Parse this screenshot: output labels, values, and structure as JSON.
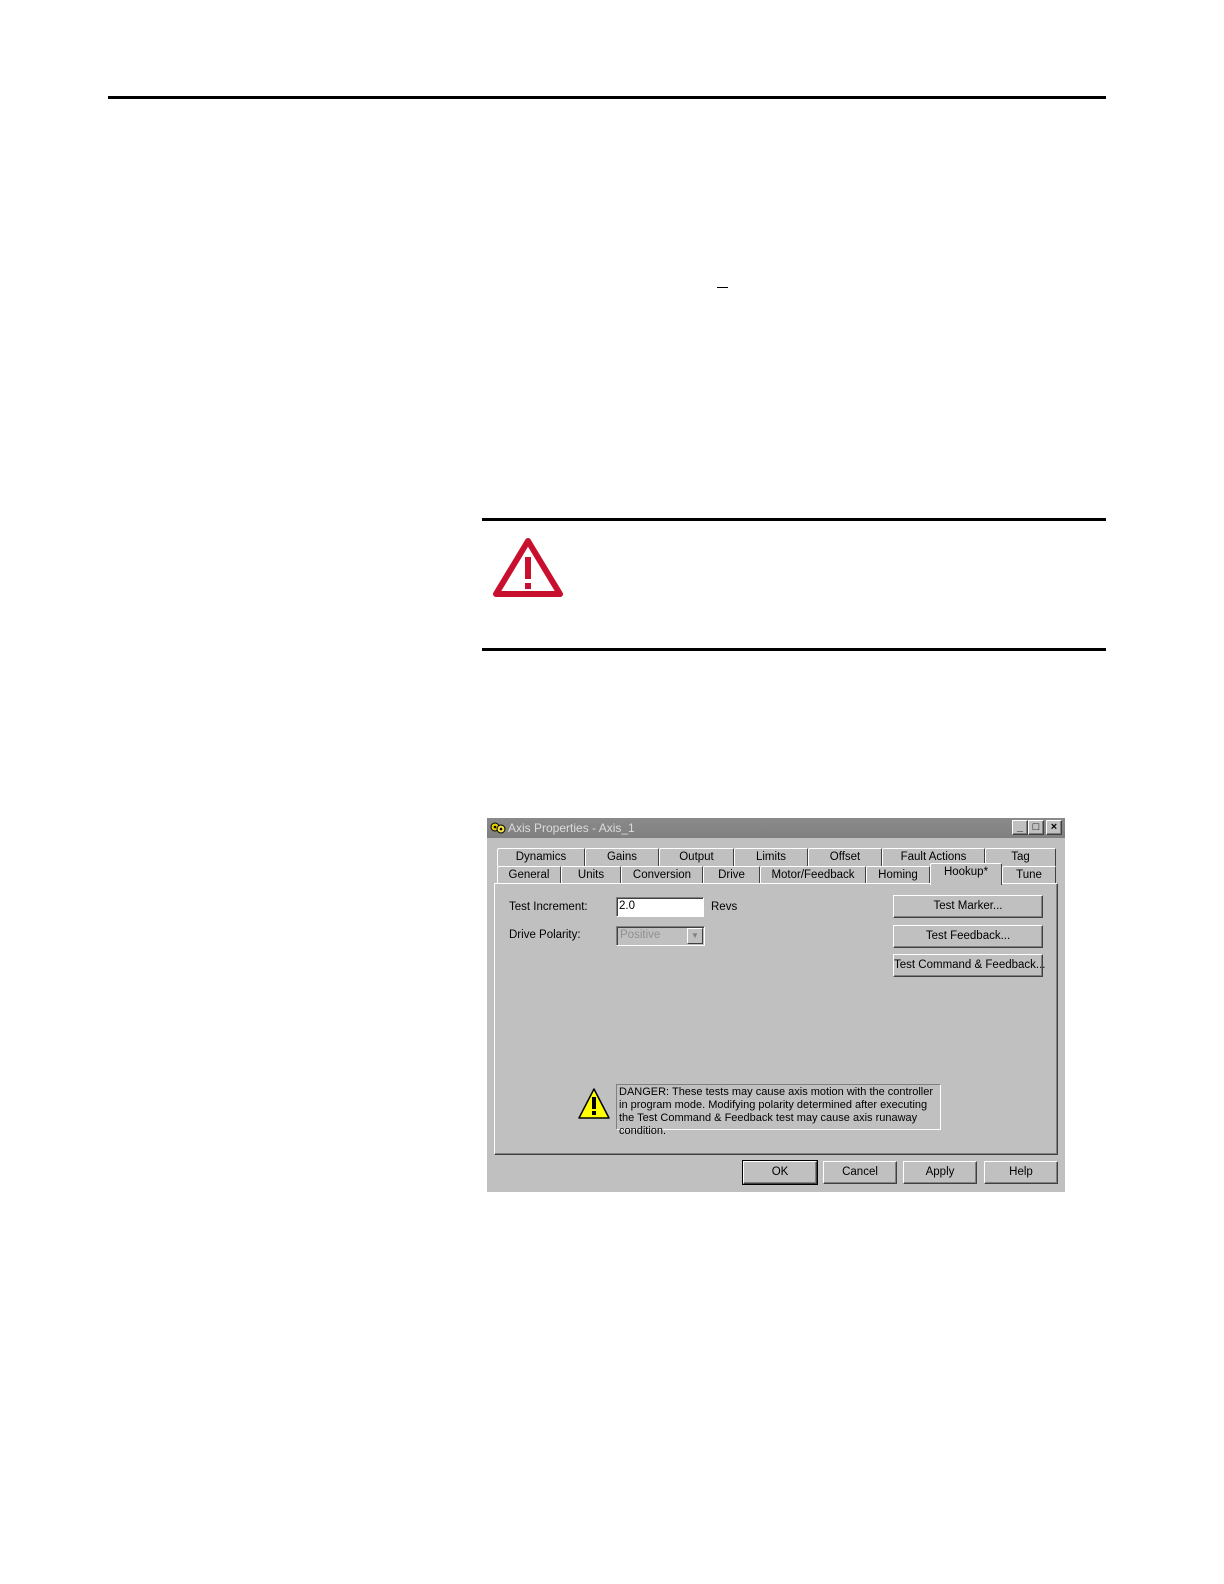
{
  "dialog": {
    "title": "Axis Properties - Axis_1",
    "window_buttons": {
      "minimize": "_",
      "maximize": "□",
      "close": "×"
    },
    "tabs_back_row": [
      "Dynamics",
      "Gains",
      "Output",
      "Limits",
      "Offset",
      "Fault Actions",
      "Tag"
    ],
    "tabs_front_row": [
      "General",
      "Units",
      "Conversion",
      "Drive",
      "Motor/Feedback",
      "Homing",
      "Hookup*",
      "Tune"
    ],
    "active_tab": "Hookup*",
    "test_increment": {
      "label": "Test Increment:",
      "value": "2.0",
      "unit": "Revs"
    },
    "drive_polarity": {
      "label": "Drive Polarity:",
      "value": "Positive"
    },
    "buttons": {
      "test_marker": "Test Marker...",
      "test_feedback": "Test Feedback...",
      "test_command_feedback": "Test Command & Feedback...",
      "ok": "OK",
      "cancel": "Cancel",
      "apply": "Apply",
      "help": "Help"
    },
    "danger_message": "DANGER: These tests may cause axis motion with the controller in program mode. Modifying polarity determined after executing the Test Command & Feedback test may cause axis runaway condition."
  },
  "colors": {
    "attention_red": "#c8102e",
    "warning_yellow": "#ffff00",
    "dialog_face": "#c0c0c0"
  }
}
